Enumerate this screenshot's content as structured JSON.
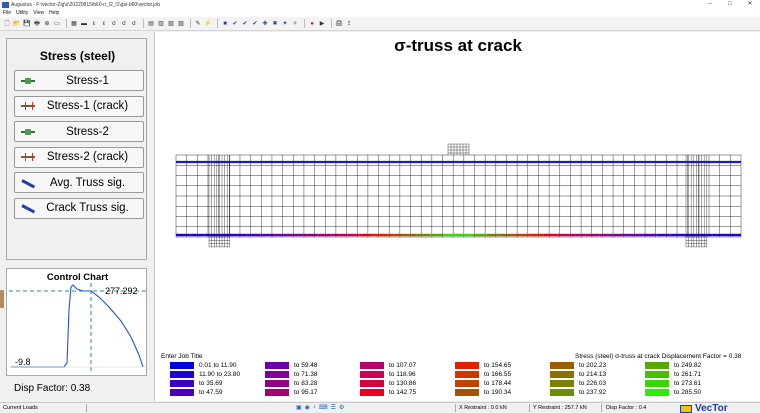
{
  "window": {
    "title": "Augustus - F:\\vector-Zig\\s\\20220815\\b60-n_l2_l1\\gsl-b60\\vector.job",
    "min": "–",
    "max": "□",
    "close": "✕"
  },
  "menu": [
    "File",
    "Utility",
    "View",
    "Help"
  ],
  "toolbar_icons": [
    "new-icon",
    "open-icon",
    "save-icon",
    "print-icon",
    "zoom-icon",
    "select-icon",
    "sep",
    "grid-icon",
    "bar-icon",
    "epsilon-icon",
    "epsilon-icon-2",
    "sigma-icon",
    "sigma-icon-2",
    "sigma-icon-3",
    "sep",
    "chart-icon-1",
    "chart-icon-2",
    "chart-icon-3",
    "chart-icon-4",
    "sep",
    "pencil-icon",
    "crack-icon",
    "sep",
    "save-blue-icon",
    "check-icon",
    "check-icon-2",
    "check-icon-3",
    "tool-icon",
    "tool-icon-2",
    "tool-icon-3",
    "tool-icon-4",
    "sep",
    "record-icon",
    "play-icon",
    "sep",
    "print-icon-2",
    "export-icon"
  ],
  "left_panel": {
    "title": "Stress (steel)",
    "buttons": [
      {
        "label": "Stress-1",
        "icon": "bar"
      },
      {
        "label": "Stress-1 (crack)",
        "icon": "crack"
      },
      {
        "label": "Stress-2",
        "icon": "bar"
      },
      {
        "label": "Stress-2 (crack)",
        "icon": "crack"
      },
      {
        "label": "Avg. Truss sig.",
        "icon": "diag"
      },
      {
        "label": "Crack Truss sig.",
        "icon": "diag"
      }
    ]
  },
  "control_chart": {
    "title": "Control Chart",
    "max_label": "277.292",
    "min_label": "-9.8"
  },
  "disp_factor": {
    "label": "Disp Factor:",
    "value": "0.38"
  },
  "main": {
    "title": "σ-truss at crack",
    "job_title": "Enter Job Title",
    "right_info": "Stress (steel)    σ-truss at crack    Displacement Factor = 0.38"
  },
  "legend": [
    {
      "text": "0.01 to 11.90",
      "color": "#0000e0"
    },
    {
      "text": "11.90 to 23.80",
      "color": "#1f00d4"
    },
    {
      "text": "to 35.69",
      "color": "#3b00c8"
    },
    {
      "text": "to 47.59",
      "color": "#5200b8"
    },
    {
      "text": "to 59.48",
      "color": "#6a00aa"
    },
    {
      "text": "to 71.38",
      "color": "#800098"
    },
    {
      "text": "to 83.28",
      "color": "#920088"
    },
    {
      "text": "to 95.17",
      "color": "#a60078"
    },
    {
      "text": "to 107.07",
      "color": "#b8006a"
    },
    {
      "text": "to 118.96",
      "color": "#c80056"
    },
    {
      "text": "to 130.86",
      "color": "#d8003e"
    },
    {
      "text": "to 142.75",
      "color": "#e80020"
    },
    {
      "text": "to 154.65",
      "color": "#e02000"
    },
    {
      "text": "to 166.55",
      "color": "#d03400"
    },
    {
      "text": "to 178.44",
      "color": "#c04400"
    },
    {
      "text": "to 190.34",
      "color": "#a85200"
    },
    {
      "text": "to 202.23",
      "color": "#9a6000"
    },
    {
      "text": "to 214.13",
      "color": "#8a7000"
    },
    {
      "text": "to 226.03",
      "color": "#7a8000"
    },
    {
      "text": "to 237.92",
      "color": "#6a9000"
    },
    {
      "text": "to 249.82",
      "color": "#58a800"
    },
    {
      "text": "to 261.71",
      "color": "#48c000"
    },
    {
      "text": "to 273.61",
      "color": "#38d800"
    },
    {
      "text": "to 285.50",
      "color": "#28f000"
    }
  ],
  "status": {
    "left": "Current Loads",
    "x_restraint": "X Restraint :  0.0 kN",
    "y_restraint": "Y Restraint :  257.7 kN",
    "disp_factor": "Disp Factor :  0.4",
    "logo": "VecTor"
  }
}
